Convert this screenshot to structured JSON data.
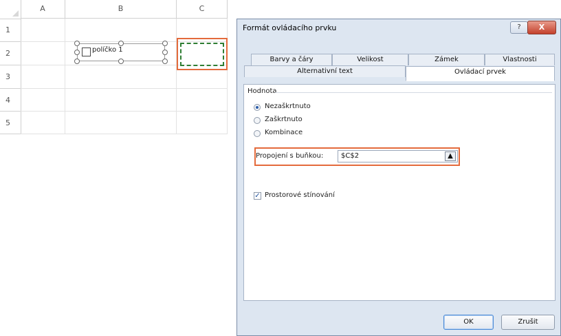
{
  "sheet": {
    "columns": [
      "A",
      "B",
      "C"
    ],
    "rows": [
      "1",
      "2",
      "3",
      "4",
      "5"
    ],
    "checkbox_label": "políčko 1"
  },
  "dialog": {
    "title": "Formát ovládacího prvku",
    "help_symbol": "?",
    "close_symbol": "X",
    "tabs_row1": [
      "Barvy a čáry",
      "Velikost",
      "Zámek",
      "Vlastnosti"
    ],
    "tabs_row2": [
      "Alternativní text",
      "Ovládací prvek"
    ],
    "active_tab": "Ovládací prvek",
    "value_group_label": "Hodnota",
    "options": [
      "Nezaškrtnuto",
      "Zaškrtnuto",
      "Kombinace"
    ],
    "selected_option": "Nezaškrtnuto",
    "cell_link_label": "Propojení s buňkou:",
    "cell_link_value": "$C$2",
    "collapse_icon": "collapse-dialog-icon",
    "shading_label": "Prostorové stínování",
    "shading_checked": true,
    "ok_label": "OK",
    "cancel_label": "Zrušit"
  },
  "colors": {
    "highlight": "#e46a3b",
    "marquee": "#2e7d32",
    "dialog_bg": "#dde6f1"
  }
}
